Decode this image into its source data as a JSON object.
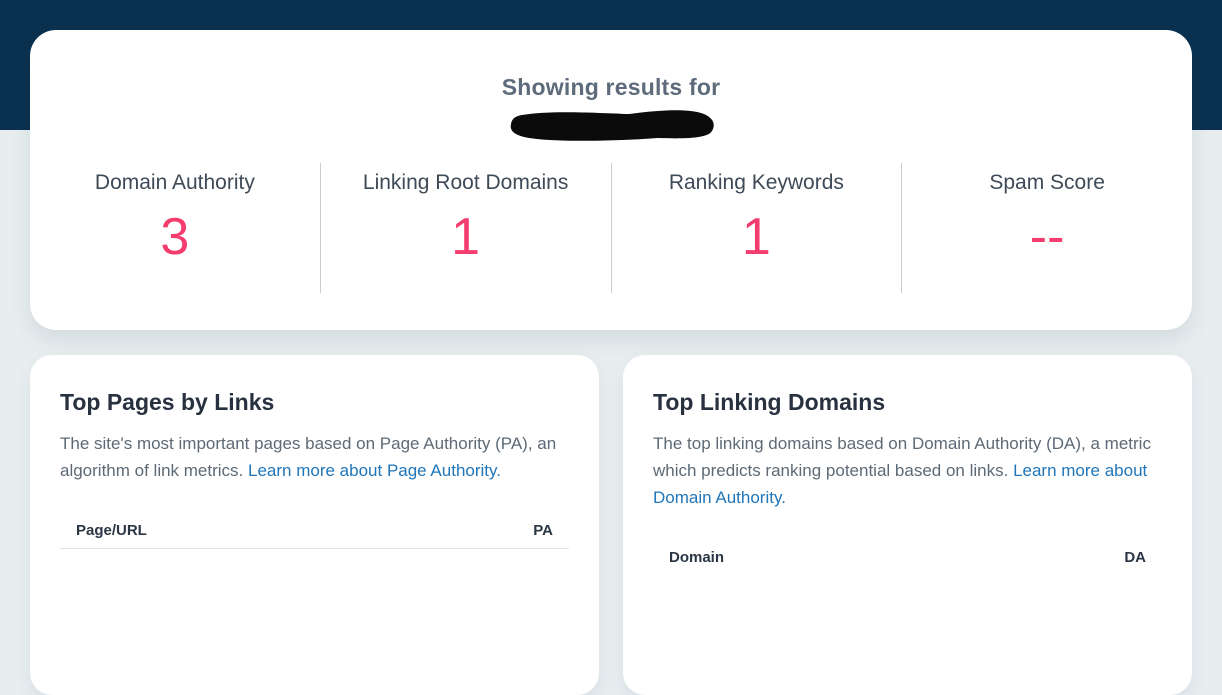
{
  "page": {
    "title": "Showing results for",
    "redacted_domain": true
  },
  "metrics": [
    {
      "label": "Domain Authority",
      "value": "3"
    },
    {
      "label": "Linking Root Domains",
      "value": "1"
    },
    {
      "label": "Ranking Keywords",
      "value": "1"
    },
    {
      "label": "Spam Score",
      "value": "--"
    }
  ],
  "cards": [
    {
      "title": "Top Pages by Links",
      "description": "The site's most important pages based on Page Authority (PA), an algorithm of link metrics.",
      "link_text": "Learn more about Page Authority.",
      "columns": [
        "Page/URL",
        "PA"
      ]
    },
    {
      "title": "Top Linking Domains",
      "description": "The top linking domains based on Domain Authority (DA), a metric which predicts ranking potential based on links.",
      "link_text": "Learn more about Domain Authority.",
      "columns": [
        "Domain",
        "DA"
      ]
    }
  ],
  "colors": {
    "navy_header": "#0b3150",
    "page_background": "#e8eef0",
    "metric_pink": "#f43c6e",
    "link_blue": "#2076b9",
    "heading_dark": "#28313f"
  }
}
